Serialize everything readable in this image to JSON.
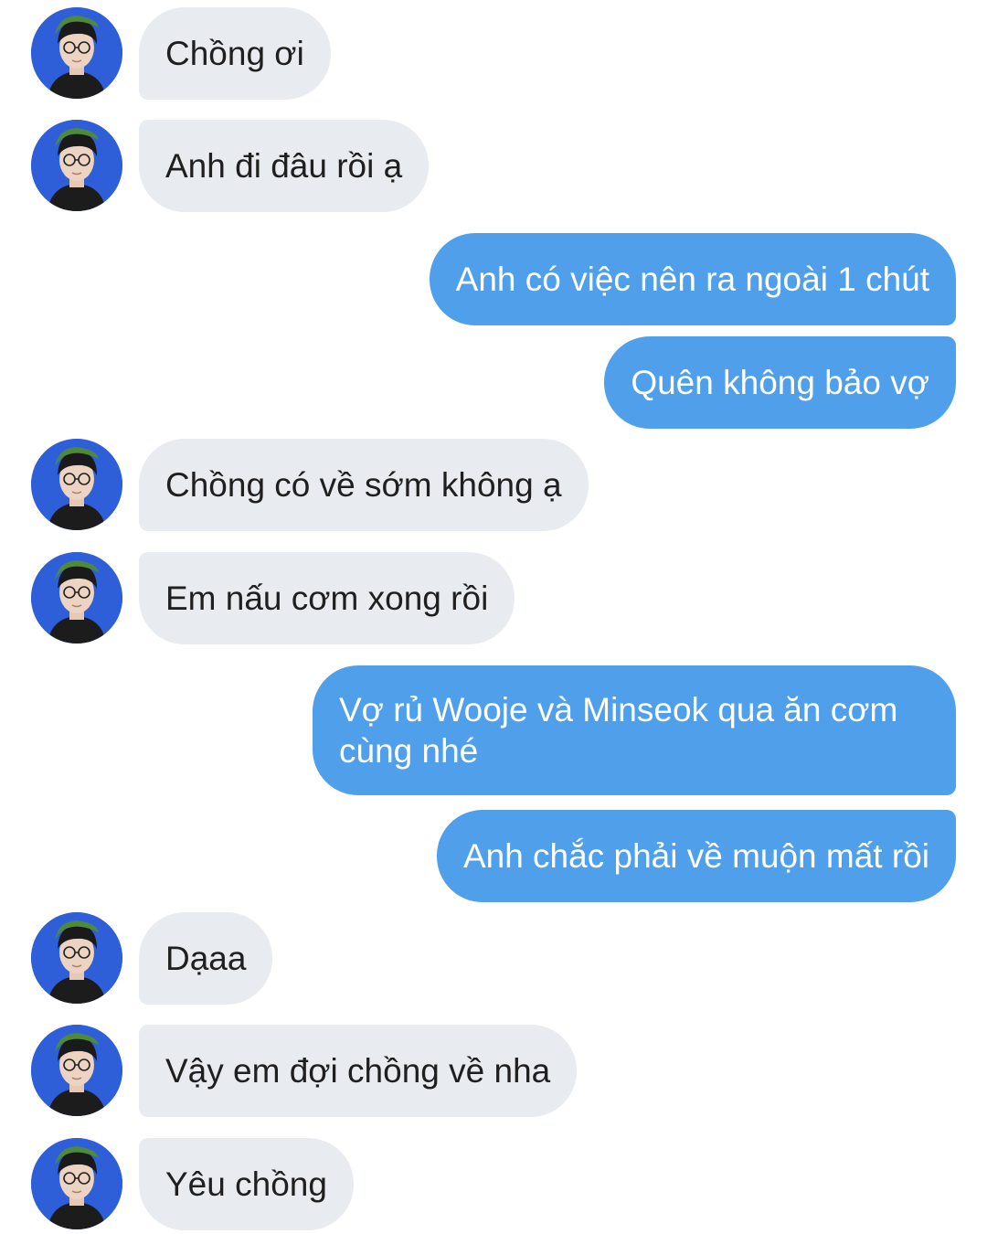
{
  "messages": [
    {
      "sender": "contact",
      "text": "Chồng ơi"
    },
    {
      "sender": "contact",
      "text": "Anh đi đâu rồi ạ"
    },
    {
      "sender": "me",
      "text": "Anh có việc nên ra ngoài 1 chút"
    },
    {
      "sender": "me",
      "text": "Quên không bảo vợ"
    },
    {
      "sender": "contact",
      "text": "Chồng có về sớm không ạ"
    },
    {
      "sender": "contact",
      "text": "Em nấu cơm xong rồi"
    },
    {
      "sender": "me",
      "text": "Vợ rủ Wooje và Minseok qua ăn cơm cùng nhé"
    },
    {
      "sender": "me",
      "text": "Anh chắc phải về muộn mất rồi"
    },
    {
      "sender": "contact",
      "text": "Dạaa"
    },
    {
      "sender": "contact",
      "text": "Vậy em đợi chồng về nha"
    },
    {
      "sender": "contact",
      "text": "Yêu chồng"
    }
  ],
  "colors": {
    "incoming_bubble": "#e8ebef",
    "outgoing_bubble": "#4f9fea",
    "avatar_background": "#2f5fd8"
  },
  "icons": {
    "contact_avatar": "contact-avatar-icon"
  }
}
